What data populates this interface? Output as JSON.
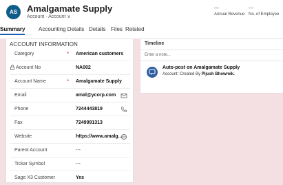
{
  "header": {
    "avatar_initials": "AS",
    "title": "Amalgamate Supply",
    "subtitle": "Account · Account ∨",
    "fields": [
      {
        "value": "---",
        "label": "Annual Revenue"
      },
      {
        "value": "---",
        "label": "No. of Employee"
      }
    ]
  },
  "tabs": [
    "Summary",
    "Accounting Details",
    "Details",
    "Files",
    "Related"
  ],
  "account_info": {
    "section_title": "ACCOUNT INFORMATION",
    "rows": [
      {
        "label": "Category",
        "value": "American customers",
        "required": "*"
      },
      {
        "label": "Account No",
        "value": "NA002",
        "locked": true
      },
      {
        "label": "Account Name",
        "value": "Amalgamate Supply",
        "required": "*"
      },
      {
        "label": "Email",
        "value": "amal@ycorp.com",
        "icon": "email-icon"
      },
      {
        "label": "Phone",
        "value": "7244443819",
        "icon": "phone-icon"
      },
      {
        "label": "Fax",
        "value": "7249991313"
      },
      {
        "label": "Website",
        "value": "https://www.amalg...",
        "icon": "globe-icon"
      },
      {
        "label": "Parent Account",
        "value": "---"
      },
      {
        "label": "Tickar Symbol",
        "value": "---"
      },
      {
        "label": "Sage X3 Customer",
        "value": "Yes"
      }
    ]
  },
  "timeline": {
    "title": "Timeline",
    "note_placeholder": "Enter a note...",
    "post": {
      "title": "Auto-post on Amalgamate Supply",
      "prefix": "Account: Created By ",
      "author": "Pijush Bhowmik."
    }
  },
  "colors": {
    "accent": "#1a5fb4",
    "avatar": "#0f5e8a",
    "background": "#f4dfe2"
  }
}
